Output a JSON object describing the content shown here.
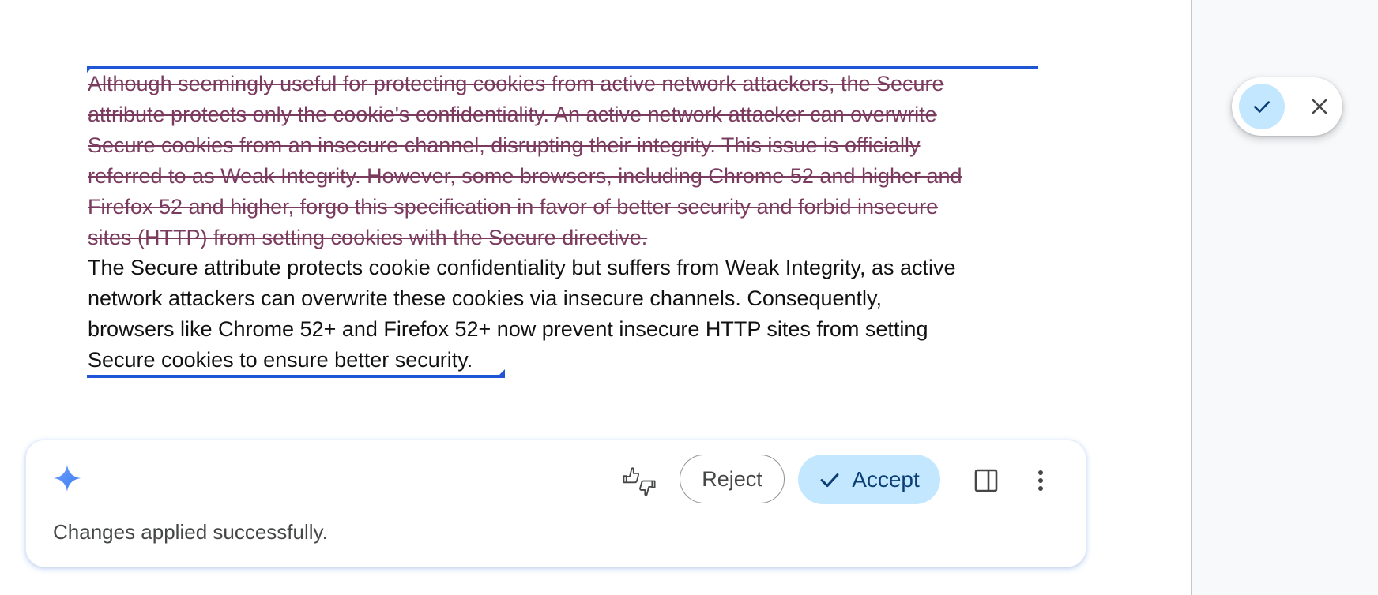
{
  "document": {
    "deleted_lines": [
      "Although seemingly useful for protecting cookies from active network attackers, the Secure",
      "attribute protects only the cookie's confidentiality. An active network attacker can overwrite",
      "Secure cookies from an insecure channel, disrupting their integrity. This issue is officially",
      "referred to as Weak Integrity. However, some browsers, including Chrome 52 and higher and",
      "Firefox 52 and higher, forgo this specification in favor of better security and forbid insecure",
      "sites (HTTP) from setting cookies with the Secure directive."
    ],
    "inserted_lines": [
      "The Secure attribute protects cookie confidentiality but suffers from Weak Integrity, as active",
      "network attackers can overwrite these cookies via insecure channels. Consequently,",
      "browsers like Chrome 52+ and Firefox 52+ now prevent insecure HTTP sites from setting",
      "Secure cookies to ensure better security."
    ]
  },
  "suggestion_pill": {
    "accept_icon": "check-icon",
    "reject_icon": "close-icon"
  },
  "ai_panel": {
    "icon": "sparkle-icon",
    "status": "Changes applied successfully.",
    "feedback_icon": "thumbs-up-down-icon",
    "reject_label": "Reject",
    "accept_label": "Accept",
    "side_panel_icon": "side-panel-icon",
    "more_icon": "more-vert-icon"
  },
  "colors": {
    "deleted_text": "#7b3b5e",
    "selection": "#1f56d6",
    "accept_bg": "#c2e7ff",
    "accept_text": "#0b3e75",
    "sparkle": "#4f8ef7"
  }
}
